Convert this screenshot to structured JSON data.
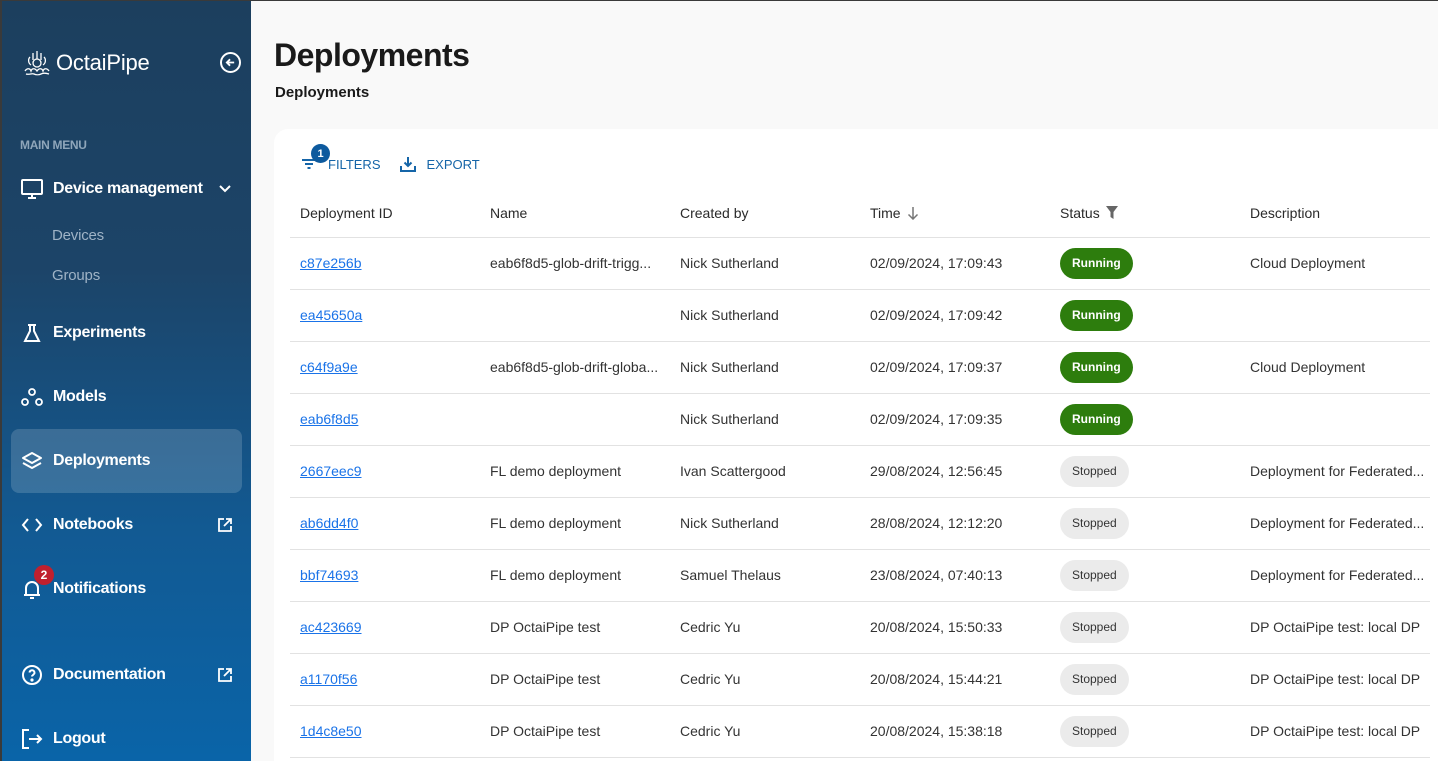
{
  "brand": {
    "name": "OctaiPipe"
  },
  "sidebar": {
    "heading": "MAIN MENU",
    "device_management": {
      "label": "Device management",
      "children": [
        {
          "label": "Devices"
        },
        {
          "label": "Groups"
        }
      ]
    },
    "items": [
      {
        "label": "Experiments",
        "icon": "flask-icon"
      },
      {
        "label": "Models",
        "icon": "models-icon"
      },
      {
        "label": "Deployments",
        "icon": "layers-icon",
        "active": true
      },
      {
        "label": "Notebooks",
        "icon": "code-icon",
        "external": true
      },
      {
        "label": "Notifications",
        "icon": "bell-icon",
        "badge": "2"
      },
      {
        "label": "Documentation",
        "icon": "help-circle-icon",
        "external": true
      },
      {
        "label": "Logout",
        "icon": "logout-icon"
      }
    ]
  },
  "header": {
    "title": "Deployments",
    "breadcrumb": "Deployments"
  },
  "toolbar": {
    "filters_label": "FILTERS",
    "filters_count": "1",
    "export_label": "EXPORT"
  },
  "table": {
    "columns": [
      "Deployment ID",
      "Name",
      "Created by",
      "Time",
      "Status",
      "Description"
    ],
    "sort": {
      "column": "Time",
      "direction": "descending"
    },
    "rows": [
      {
        "id": "c87e256b",
        "name": "eab6f8d5-glob-drift-trigg...",
        "created_by": "Nick Sutherland",
        "time": "02/09/2024, 17:09:43",
        "status": "Running",
        "description": "Cloud Deployment"
      },
      {
        "id": "ea45650a",
        "name": "",
        "created_by": "Nick Sutherland",
        "time": "02/09/2024, 17:09:42",
        "status": "Running",
        "description": ""
      },
      {
        "id": "c64f9a9e",
        "name": "eab6f8d5-glob-drift-globa...",
        "created_by": "Nick Sutherland",
        "time": "02/09/2024, 17:09:37",
        "status": "Running",
        "description": "Cloud Deployment"
      },
      {
        "id": "eab6f8d5",
        "name": "",
        "created_by": "Nick Sutherland",
        "time": "02/09/2024, 17:09:35",
        "status": "Running",
        "description": ""
      },
      {
        "id": "2667eec9",
        "name": "FL demo deployment",
        "created_by": "Ivan Scattergood",
        "time": "29/08/2024, 12:56:45",
        "status": "Stopped",
        "description": "Deployment for Federated..."
      },
      {
        "id": "ab6dd4f0",
        "name": "FL demo deployment",
        "created_by": "Nick Sutherland",
        "time": "28/08/2024, 12:12:20",
        "status": "Stopped",
        "description": "Deployment for Federated..."
      },
      {
        "id": "bbf74693",
        "name": "FL demo deployment",
        "created_by": "Samuel Thelaus",
        "time": "23/08/2024, 07:40:13",
        "status": "Stopped",
        "description": "Deployment for Federated..."
      },
      {
        "id": "ac423669",
        "name": "DP OctaiPipe test",
        "created_by": "Cedric Yu",
        "time": "20/08/2024, 15:50:33",
        "status": "Stopped",
        "description": "DP OctaiPipe test: local DP"
      },
      {
        "id": "a1170f56",
        "name": "DP OctaiPipe test",
        "created_by": "Cedric Yu",
        "time": "20/08/2024, 15:44:21",
        "status": "Stopped",
        "description": "DP OctaiPipe test: local DP"
      },
      {
        "id": "1d4c8e50",
        "name": "DP OctaiPipe test",
        "created_by": "Cedric Yu",
        "time": "20/08/2024, 15:38:18",
        "status": "Stopped",
        "description": "DP OctaiPipe test: local DP"
      }
    ]
  },
  "colors": {
    "sidebar_top": "#1c3f5e",
    "sidebar_bottom": "#0a64a8",
    "running": "#2d7d0d",
    "stopped": "#ebebeb",
    "link": "#1a73e8",
    "accent": "#1565a8",
    "notification_badge": "#c0202e"
  }
}
